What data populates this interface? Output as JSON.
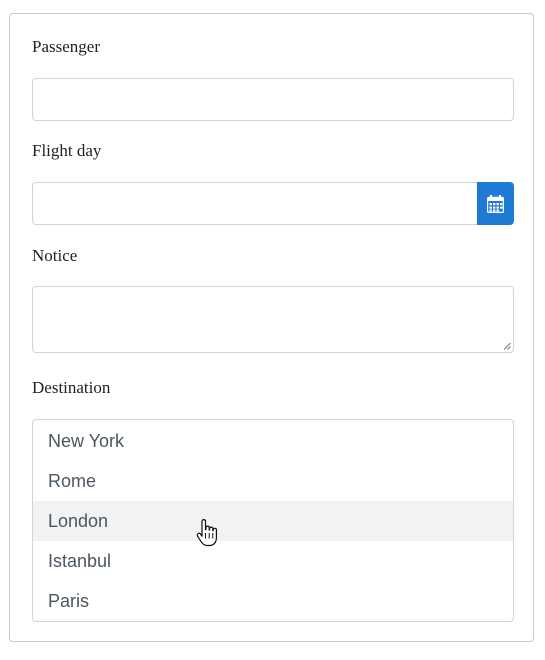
{
  "form": {
    "passenger": {
      "label": "Passenger",
      "value": "",
      "placeholder": ""
    },
    "flight_day": {
      "label": "Flight day",
      "value": "",
      "placeholder": "",
      "button_icon": "calendar-icon"
    },
    "notice": {
      "label": "Notice",
      "value": ""
    },
    "destination": {
      "label": "Destination",
      "options": [
        "New York",
        "Rome",
        "London",
        "Istanbul",
        "Paris"
      ],
      "hovered_option": "London"
    }
  },
  "colors": {
    "accent": "#1f7ad3",
    "border": "#d4d4d4",
    "hover_row": "#f2f2f2",
    "option_text": "#4a5661",
    "label_text": "#222222"
  },
  "cursor_icon": "hand-pointer-icon"
}
